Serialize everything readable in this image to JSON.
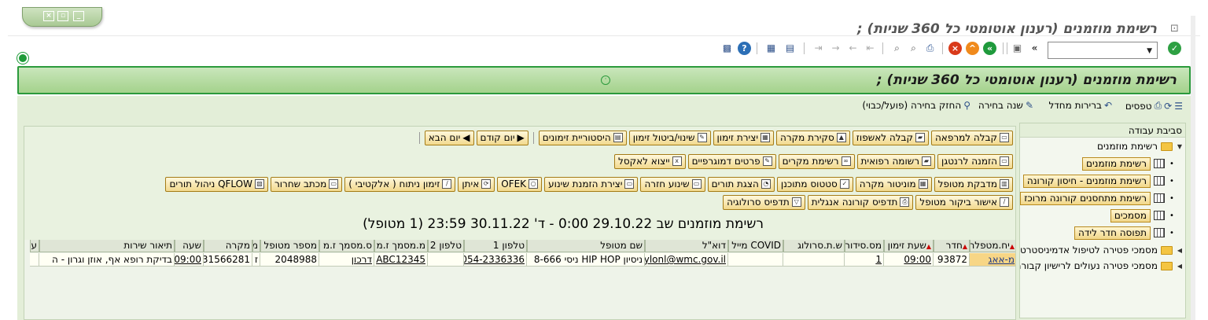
{
  "window": {
    "title": "רשימת מוזמנים (רענון אוטומטי כל 360 שניות)  ;",
    "tab_buttons": [
      "×",
      "▫",
      "_"
    ]
  },
  "toolbar": {
    "command_value": "",
    "icons": [
      "green-check-icon",
      "double-left-icon",
      "save-icon",
      "back-icon",
      "exit-icon",
      "cancel-icon",
      "print-icon",
      "find-icon",
      "find-next-icon",
      "first-page-icon",
      "prev-page-icon",
      "next-page-icon",
      "last-page-icon",
      "new-session-icon",
      "shortcut-icon",
      "help-icon",
      "customize-icon"
    ]
  },
  "header": {
    "title": "רשימת מוזמנים (רענון אוטומטי כל 360 שניות)  ;"
  },
  "appbar": {
    "items": [
      "טפסים",
      "ברירות מחדל",
      "שנה בחירה",
      "החזק בחירה (פועל/כבוי)"
    ]
  },
  "nav": {
    "heading": "סביבת עבודה",
    "root": "רשימת מוזמנים",
    "items": [
      "רשימת מוזמנים",
      "רשימת מוזמנים - חיסון קורונה",
      "רשימת מתחסנים קורונה מרוכז",
      "מסמכים",
      "תפוסה חדר לידה"
    ],
    "folders": [
      "מסמכי פטירה לטיפול אדמיניסטרטיבי",
      "מסמכי פטירה נעולים לרישיון קבורה"
    ]
  },
  "actions": {
    "row1": [
      "קבלה למרפאה",
      "קבלה לאשפוז",
      "סקירת מקרה",
      "יצירת זימון",
      "שינוי/ביטול זימון",
      "היסטוריית זימונים",
      "יום קודם",
      "יום הבא"
    ],
    "row2": [
      "הזמנה לרנטגן",
      "רשומה רפואית",
      "רשימת מקרים",
      "פרטים דמוגרפיים",
      "ייצוא לאקסל"
    ],
    "row3": [
      "מדבקת מטופל",
      "מוניטור מקרה",
      "סטטוס מתוכנן",
      "הצגת תורים",
      "שינוע חזרה",
      "יצירת הזמנת שינוע",
      "OFEK",
      "איתן",
      "זימון ניתוח ( אלקטיבי )",
      "מכתב שחרור",
      "QFLOW ניהול תורים"
    ],
    "row4": [
      "אישור ביקור מטופל",
      "תדפיס קורונה אנגלית",
      "תדפיס סרולוגיה"
    ]
  },
  "list": {
    "title": "רשימת מוזמנים שב  29.10.22  0:00 - ד' 30.11.22 23:59  (1  מטופל)"
  },
  "table": {
    "columns": [
      "יח.מטפלת",
      "חדר",
      "שעת זימון",
      "מס.סידורי",
      "ש.ת.סרולוג",
      "COVID מייל",
      "דוא\"ל",
      "שם מטופל",
      "טלפון 1",
      "טלפון 2",
      "מ.מסמך ז.מ",
      "ס.מסמך ז.מ",
      "מספר מטופל",
      "מ",
      "מקרה",
      "שעה",
      "תיאור שירות",
      "ע"
    ],
    "rows": [
      [
        "מ-אאג",
        "93872",
        "09:00",
        "1",
        "",
        "",
        "eylonl@wmc.gov.il",
        "ניסיון HIP HOP ניסי 8-666",
        "054-2336336",
        "",
        "ABC12345",
        "דרכון",
        "2048988",
        "ז",
        "31566281",
        "09:00",
        "בדיקת רופא אף, אוזן וגרון - ה",
        ""
      ]
    ]
  },
  "colors": {
    "accent_green": "#2b9a3c",
    "button_gold": "#f2d98e"
  }
}
